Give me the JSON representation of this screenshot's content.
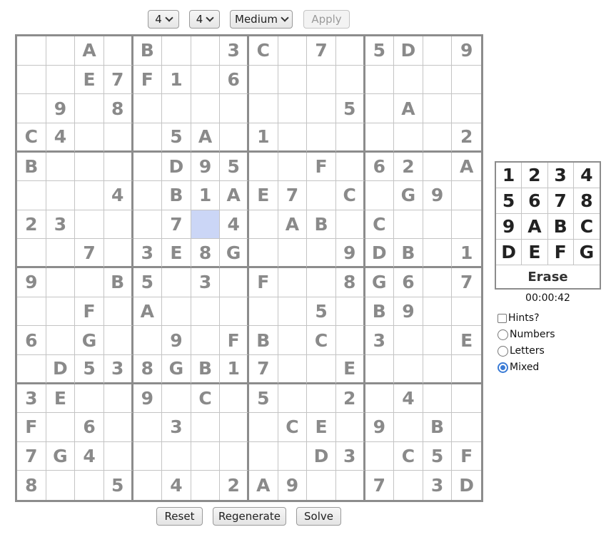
{
  "toolbar": {
    "box_rows": "4",
    "box_cols": "4",
    "difficulty": "Medium",
    "apply_label": "Apply"
  },
  "board": {
    "rows": [
      [
        "",
        "",
        "A",
        "",
        "B",
        "",
        "",
        "3",
        "C",
        "",
        "7",
        "",
        "5",
        "D",
        "",
        "9"
      ],
      [
        "",
        "",
        "E",
        "7",
        "F",
        "1",
        "",
        "6",
        "",
        "",
        "",
        "",
        "",
        "",
        "",
        ""
      ],
      [
        "",
        "9",
        "",
        "8",
        "",
        "",
        "",
        "",
        "",
        "",
        "",
        "5",
        "",
        "A",
        "",
        ""
      ],
      [
        "C",
        "4",
        "",
        "",
        "",
        "5",
        "A",
        "",
        "1",
        "",
        "",
        "",
        "",
        "",
        "",
        "2"
      ],
      [
        "B",
        "",
        "",
        "",
        "",
        "D",
        "9",
        "5",
        "",
        "",
        "F",
        "",
        "6",
        "2",
        "",
        "A"
      ],
      [
        "",
        "",
        "",
        "4",
        "",
        "B",
        "1",
        "A",
        "E",
        "7",
        "",
        "C",
        "",
        "G",
        "9",
        ""
      ],
      [
        "2",
        "3",
        "",
        "",
        "",
        "7",
        "",
        "4",
        "",
        "A",
        "B",
        "",
        "C",
        "",
        "",
        ""
      ],
      [
        "",
        "",
        "7",
        "",
        "3",
        "E",
        "8",
        "G",
        "",
        "",
        "",
        "9",
        "D",
        "B",
        "",
        "1"
      ],
      [
        "9",
        "",
        "",
        "B",
        "5",
        "",
        "3",
        "",
        "F",
        "",
        "",
        "8",
        "G",
        "6",
        "",
        "7"
      ],
      [
        "",
        "",
        "F",
        "",
        "A",
        "",
        "",
        "",
        "",
        "",
        "5",
        "",
        "B",
        "9",
        "",
        ""
      ],
      [
        "6",
        "",
        "G",
        "",
        "",
        "9",
        "",
        "F",
        "B",
        "",
        "C",
        "",
        "3",
        "",
        "",
        "E"
      ],
      [
        "",
        "D",
        "5",
        "3",
        "8",
        "G",
        "B",
        "1",
        "7",
        "",
        "",
        "E",
        "",
        "",
        "",
        ""
      ],
      [
        "3",
        "E",
        "",
        "",
        "9",
        "",
        "C",
        "",
        "5",
        "",
        "",
        "2",
        "",
        "4",
        "",
        ""
      ],
      [
        "F",
        "",
        "6",
        "",
        "",
        "3",
        "",
        "",
        "",
        "C",
        "E",
        "",
        "9",
        "",
        "B",
        ""
      ],
      [
        "7",
        "G",
        "4",
        "",
        "",
        "",
        "",
        "",
        "",
        "",
        "D",
        "3",
        "",
        "C",
        "5",
        "F"
      ],
      [
        "8",
        "",
        "",
        "5",
        "",
        "4",
        "",
        "2",
        "A",
        "9",
        "",
        "",
        "7",
        "",
        "3",
        "D"
      ]
    ],
    "selected_cell": {
      "row": 6,
      "col": 6
    },
    "selected_color": "#cbd6f6",
    "given_color": "#8a8a8a"
  },
  "keypad": {
    "keys": [
      "1",
      "2",
      "3",
      "4",
      "5",
      "6",
      "7",
      "8",
      "9",
      "A",
      "B",
      "C",
      "D",
      "E",
      "F",
      "G"
    ],
    "erase_label": "Erase"
  },
  "timer": "00:00:42",
  "options": {
    "hints_label": "Hints?",
    "hints_checked": false,
    "modes": [
      {
        "label": "Numbers",
        "selected": false
      },
      {
        "label": "Letters",
        "selected": false
      },
      {
        "label": "Mixed",
        "selected": true
      }
    ]
  },
  "bottom_buttons": {
    "reset_label": "Reset",
    "regenerate_label": "Regenerate",
    "solve_label": "Solve"
  }
}
